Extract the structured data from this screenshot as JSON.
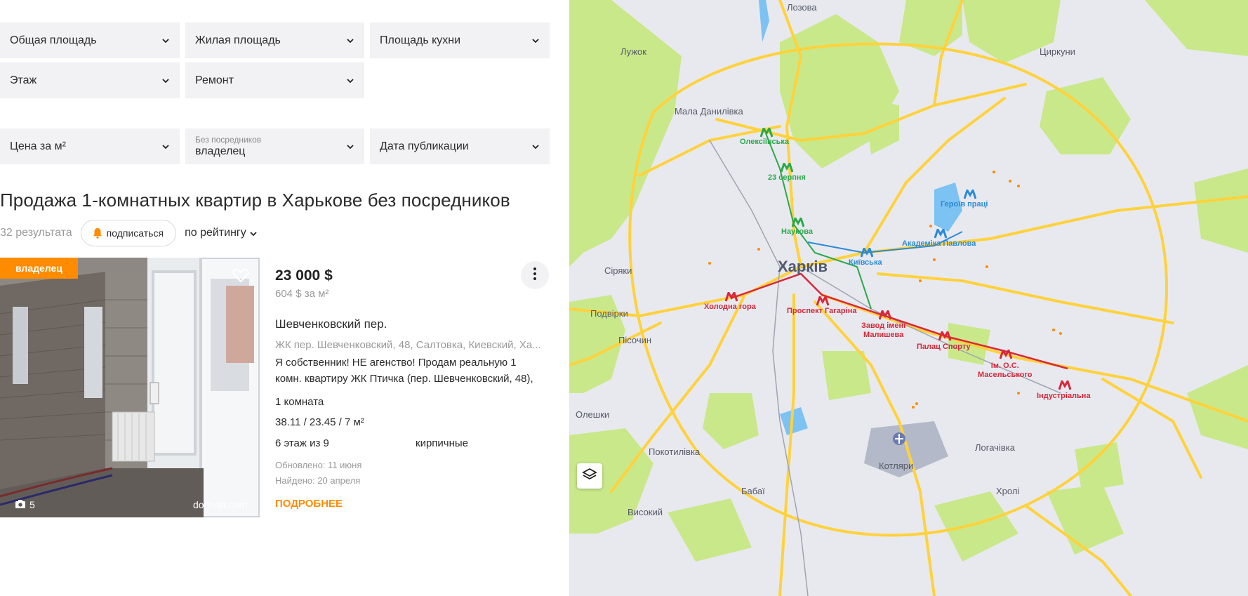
{
  "filters": {
    "total_area": "Общая площадь",
    "living_area": "Жилая площадь",
    "kitchen_area": "Площадь кухни",
    "floor": "Этаж",
    "repair": "Ремонт",
    "price_per_m2": "Цена за м²",
    "intermediary_label": "Без посредников",
    "intermediary_value": "владелец",
    "publish_date": "Дата публикации"
  },
  "heading": "Продажа 1-комнатных квартир в Харькове без посредников",
  "results": {
    "count": "32 результата",
    "subscribe": "подписаться",
    "sort": "по рейтингу"
  },
  "listing": {
    "badge": "владелец",
    "photo_count": "5",
    "source": "dom.ria.com",
    "price": "23 000 $",
    "price_per_m2": "604 $ за м²",
    "street": "Шевченковский пер.",
    "address": "ЖК пер. Шевченковский, 48, Салтовка, Киевский, Ха...",
    "description": "Я собственник! НЕ агенство! Продам реальную 1 комн. квартиру ЖК Птичка (пер. Шевченковский, 48),",
    "rooms": "1 комната",
    "area": "38.11 / 23.45 / 7 м²",
    "floor": "6 этаж из 9",
    "walls": "кирпичные",
    "updated": "Обновлено: 11 июня",
    "found": "Найдено: 20 апреля",
    "more": "ПОДРОБНЕЕ"
  },
  "map": {
    "city": "Харків",
    "places": {
      "lozova": "Лозова",
      "luzhok": "Лужок",
      "tsyrkuny": "Циркуни",
      "mala_danylivka": "Мала Данилівка",
      "siriaky": "Сіряки",
      "podvirky": "Подвірки",
      "pisochyn": "Пісочин",
      "oleshky": "Олешки",
      "pokotylivka": "Покотилівка",
      "babai": "Бабаї",
      "vysokyi": "Високий",
      "kotliary": "Котляри",
      "lohachivka": "Логачівка",
      "khroli": "Хролі"
    },
    "metro": {
      "oleksiivska": "Олексіївська",
      "serpnia": "23 серпня",
      "naukova": "Наукова",
      "heroiv_pratsi": "Героїв праці",
      "akademika_pavlova": "Академіка Павлова",
      "kyivska": "Київська",
      "kholodna_hora": "Холодна гора",
      "prospekt_haharina": "Проспект Гагаріна",
      "zavod_1": "Завод імені",
      "zavod_2": "Малишева",
      "palats_sportu": "Палац Спорту",
      "maselskoho_1": "Ім. О.С.",
      "maselskoho_2": "Масельського",
      "industrialna": "Індустріальна"
    },
    "colors": {
      "green_line": "#2aa84a",
      "red_line": "#d7283a",
      "blue_line": "#2a8ad8",
      "road": "#ffd23c",
      "park": "#c9e88a",
      "water": "#7cc2f2"
    }
  }
}
